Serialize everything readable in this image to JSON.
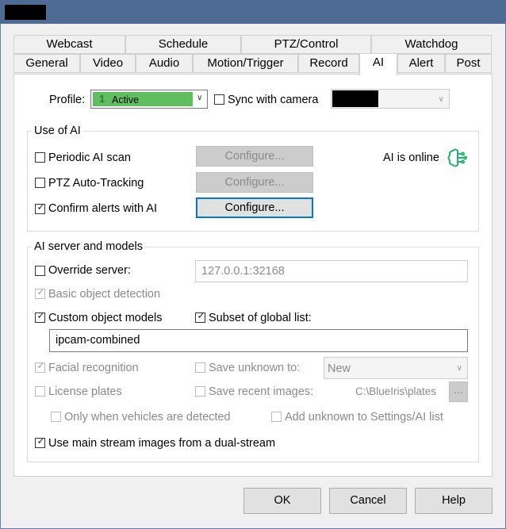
{
  "tabs_top": [
    "Webcast",
    "Schedule",
    "PTZ/Control",
    "Watchdog"
  ],
  "tabs_bottom": [
    "General",
    "Video",
    "Audio",
    "Motion/Trigger",
    "Record",
    "AI",
    "Alert",
    "Post"
  ],
  "active_tab": "AI",
  "profile": {
    "label": "Profile:",
    "value": "Active",
    "value_prefix": "1",
    "color": "#5fbf5f",
    "sync_label": "Sync with camera",
    "sync_checked": false
  },
  "use_of_ai": {
    "title": "Use of AI",
    "periodic_scan": {
      "label": "Periodic AI scan",
      "checked": false,
      "button": "Configure..."
    },
    "ptz_tracking": {
      "label": "PTZ Auto-Tracking",
      "checked": false,
      "button": "Configure..."
    },
    "confirm_alerts": {
      "label": "Confirm alerts with AI",
      "checked": true,
      "button": "Configure..."
    },
    "status": "AI is online",
    "status_color": "#21b36b"
  },
  "server": {
    "title": "AI server and models",
    "override_label": "Override server:",
    "override_checked": false,
    "override_value": "127.0.0.1:32168",
    "basic_detection": "Basic object detection",
    "custom_models": "Custom object models",
    "subset_label": "Subset of global list:",
    "models_value": "ipcam-combined",
    "facial": "Facial recognition",
    "save_unknown": "Save unknown to:",
    "save_unknown_value": "New",
    "license_plates": "License plates",
    "save_recent": "Save recent images:",
    "save_recent_path": "C:\\BlueIris\\plates",
    "browse": "...",
    "only_vehicles": "Only when vehicles are detected",
    "add_unknown": "Add unknown to Settings/AI list",
    "dual_stream": "Use main stream images from a dual-stream"
  },
  "footer": {
    "ok": "OK",
    "cancel": "Cancel",
    "help": "Help"
  }
}
